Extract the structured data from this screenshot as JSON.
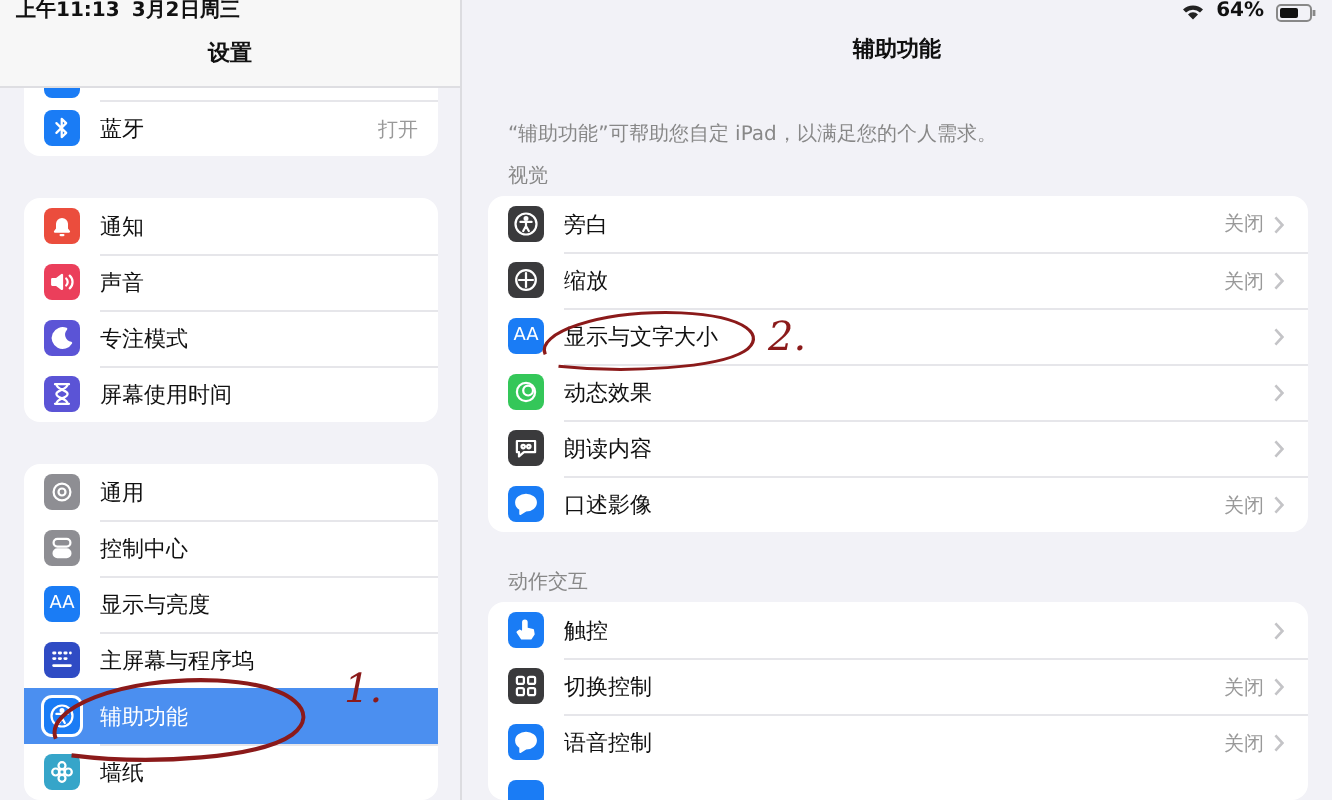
{
  "status_bar": {
    "time": "上午11:13",
    "date": "3月2日周三",
    "battery": "64%"
  },
  "sidebar": {
    "title": "设置",
    "groups": [
      {
        "clipped_icon": {
          "color": "#1a7cf5"
        },
        "items": [
          {
            "label": "蓝牙",
            "value": "打开",
            "selected": false,
            "icon": {
              "kind": "bluetooth",
              "color": "#1a7cf5"
            }
          }
        ]
      },
      {
        "items": [
          {
            "label": "通知",
            "selected": false,
            "icon": {
              "kind": "bell",
              "color": "#eb4d3d"
            }
          },
          {
            "label": "声音",
            "selected": false,
            "icon": {
              "kind": "speaker",
              "color": "#eb3f5b"
            }
          },
          {
            "label": "专注模式",
            "selected": false,
            "icon": {
              "kind": "moon",
              "color": "#5b54d6"
            }
          },
          {
            "label": "屏幕使用时间",
            "selected": false,
            "icon": {
              "kind": "hourglass",
              "color": "#5b54d6"
            }
          }
        ]
      },
      {
        "items": [
          {
            "label": "通用",
            "selected": false,
            "icon": {
              "kind": "gear",
              "color": "#8e8e93"
            }
          },
          {
            "label": "控制中心",
            "selected": false,
            "icon": {
              "kind": "toggles",
              "color": "#8e8e93"
            }
          },
          {
            "label": "显示与亮度",
            "selected": false,
            "icon": {
              "kind": "text",
              "text": "AA",
              "color": "#1a7cf5"
            }
          },
          {
            "label": "主屏幕与程序坞",
            "selected": false,
            "icon": {
              "kind": "grid",
              "color": "#2f4bc4"
            }
          },
          {
            "label": "辅助功能",
            "selected": true,
            "icon": {
              "kind": "person",
              "color": "#1a7cf5"
            }
          },
          {
            "label": "墙纸",
            "selected": false,
            "icon": {
              "kind": "flower",
              "color": "#36a5c9"
            }
          }
        ]
      }
    ]
  },
  "detail": {
    "title": "辅助功能",
    "description": "“辅助功能”可帮助您自定 iPad，以满足您的个人需求。",
    "sections": [
      {
        "header": "视觉",
        "items": [
          {
            "label": "旁白",
            "value": "关闭",
            "icon": {
              "kind": "voiceover",
              "color": "#3a3a3c"
            }
          },
          {
            "label": "缩放",
            "value": "关闭",
            "icon": {
              "kind": "zoom",
              "color": "#3a3a3c"
            }
          },
          {
            "label": "显示与文字大小",
            "icon": {
              "kind": "text",
              "text": "AA",
              "color": "#1a7cf5"
            }
          },
          {
            "label": "动态效果",
            "icon": {
              "kind": "motion",
              "color": "#34c759"
            }
          },
          {
            "label": "朗读内容",
            "icon": {
              "kind": "speech",
              "color": "#3a3a3c"
            }
          },
          {
            "label": "口述影像",
            "value": "关闭",
            "icon": {
              "kind": "bubble",
              "color": "#1a7cf5"
            }
          }
        ]
      },
      {
        "header": "动作交互",
        "items": [
          {
            "label": "触控",
            "icon": {
              "kind": "hand",
              "color": "#1a7cf5"
            }
          },
          {
            "label": "切换控制",
            "value": "关闭",
            "icon": {
              "kind": "squares",
              "color": "#3a3a3c"
            }
          },
          {
            "label": "语音控制",
            "value": "关闭",
            "icon": {
              "kind": "bubble",
              "color": "#1a7cf5"
            }
          }
        ],
        "clipped_icon": {
          "color": "#1a7cf5"
        }
      }
    ]
  },
  "annotations": [
    {
      "label": "1."
    },
    {
      "label": "2."
    }
  ]
}
